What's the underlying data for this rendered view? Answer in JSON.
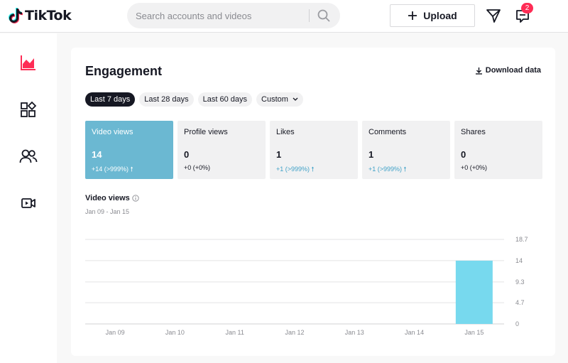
{
  "header": {
    "logo_text": "TikTok",
    "search_placeholder": "Search accounts and videos",
    "upload_label": "Upload",
    "inbox_badge": "2"
  },
  "sidebar": {
    "items": [
      {
        "icon": "analytics-icon",
        "active": true
      },
      {
        "icon": "content-icon",
        "active": false
      },
      {
        "icon": "followers-icon",
        "active": false
      },
      {
        "icon": "live-icon",
        "active": false
      }
    ]
  },
  "engagement": {
    "title": "Engagement",
    "download_label": "Download data",
    "filters": [
      "Last 7 days",
      "Last 28 days",
      "Last 60 days",
      "Custom"
    ],
    "active_filter": "Last 7 days",
    "metrics": [
      {
        "label": "Video views",
        "value": "14",
        "delta": "+14 (>999%)",
        "trend": "up",
        "active": true
      },
      {
        "label": "Profile views",
        "value": "0",
        "delta": "+0 (+0%)",
        "trend": "flat",
        "active": false
      },
      {
        "label": "Likes",
        "value": "1",
        "delta": "+1 (>999%)",
        "trend": "up",
        "active": false
      },
      {
        "label": "Comments",
        "value": "1",
        "delta": "+1 (>999%)",
        "trend": "up",
        "active": false
      },
      {
        "label": "Shares",
        "value": "0",
        "delta": "+0 (+0%)",
        "trend": "flat",
        "active": false
      }
    ],
    "chart_title": "Video views",
    "chart_range": "Jan 09 - Jan 15"
  },
  "chart_data": {
    "type": "bar",
    "categories": [
      "Jan 09",
      "Jan 10",
      "Jan 11",
      "Jan 12",
      "Jan 13",
      "Jan 14",
      "Jan 15"
    ],
    "values": [
      0,
      0,
      0,
      0,
      0,
      0,
      14
    ],
    "y_ticks": [
      "0",
      "4.7",
      "9.3",
      "14",
      "18.7"
    ],
    "ylim": [
      0,
      18.7
    ],
    "grid": true,
    "bar_color": "#77d9ee"
  },
  "colors": {
    "accent": "#fe2c55",
    "active_metric": "#6bb8d2",
    "trend_up": "#3fa1c7"
  }
}
